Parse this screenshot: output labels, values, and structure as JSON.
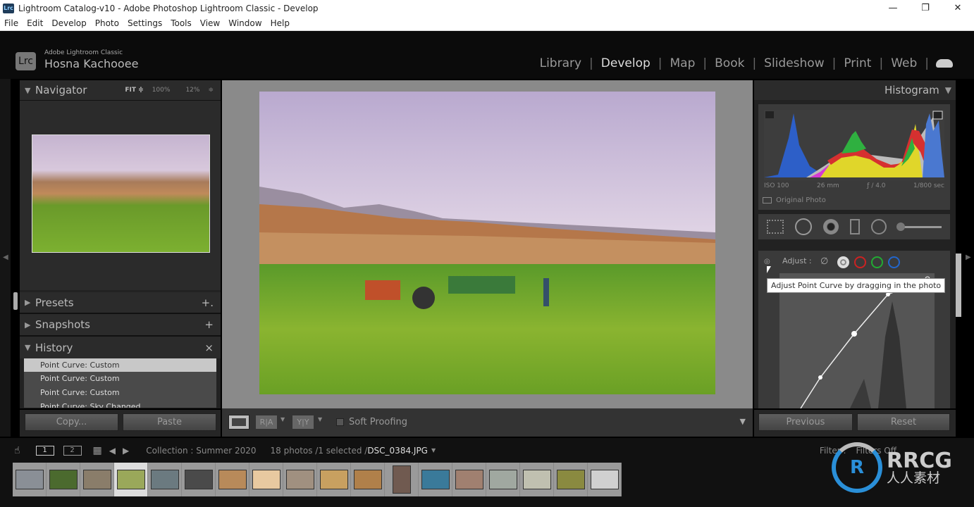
{
  "window": {
    "title": "Lightroom Catalog-v10 - Adobe Photoshop Lightroom Classic - Develop",
    "app_icon": "Lrc",
    "controls": [
      "—",
      "❐",
      "✕"
    ]
  },
  "menu": [
    "File",
    "Edit",
    "Develop",
    "Photo",
    "Settings",
    "Tools",
    "View",
    "Window",
    "Help"
  ],
  "identity": {
    "logo": "Lrc",
    "product": "Adobe Lightroom Classic",
    "user": "Hosna Kachooee"
  },
  "modules": [
    {
      "label": "Library"
    },
    {
      "label": "Develop",
      "active": true
    },
    {
      "label": "Map"
    },
    {
      "label": "Book"
    },
    {
      "label": "Slideshow"
    },
    {
      "label": "Print"
    },
    {
      "label": "Web"
    }
  ],
  "navigator": {
    "title": "Navigator",
    "fit": "FIT ≑",
    "z100": "100%",
    "z12": "12%",
    "arrows": "≑"
  },
  "presets": {
    "title": "Presets",
    "action": "+."
  },
  "snapshots": {
    "title": "Snapshots",
    "action": "+"
  },
  "history": {
    "title": "History",
    "action": "×",
    "items": [
      "Point Curve: Custom",
      "Point Curve: Custom",
      "Point Curve: Custom",
      "Point Curve: Sky Changed"
    ]
  },
  "left_buttons": {
    "copy": "Copy...",
    "paste": "Paste"
  },
  "toolbar": {
    "ra": "R|A",
    "yy": "Y|Y",
    "soft_proofing": "Soft Proofing",
    "soft_proofing_checked": false
  },
  "histogram": {
    "title": "Histogram",
    "iso": "ISO 100",
    "focal": "26 mm",
    "aperture": "ƒ / 4.0",
    "shutter": "1/800 sec",
    "original_photo": "Original Photo"
  },
  "tone_curve": {
    "adjust": "Adjust :",
    "tooltip": "Adjust Point Curve by dragging in the photo",
    "channels": [
      "#dddddd",
      "#cc2222",
      "#22aa33",
      "#2266cc"
    ]
  },
  "right_buttons": {
    "previous": "Previous",
    "reset": "Reset"
  },
  "filmstrip": {
    "view1": "1",
    "view2": "2",
    "collection": "Collection : Summer 2020",
    "count": "18 photos /1 selected /",
    "filename": "DSC_0384.JPG",
    "filter_label": "Filter :",
    "filter_value": "Filters Off",
    "thumbs": [
      "#8a8f96",
      "#4b6a2e",
      "#8a7d6a",
      "#9aa85a",
      "#6b7a80",
      "#4a4a4a",
      "#b88a5a",
      "#e8c9a0",
      "#a09080",
      "#c8a060",
      "#b0804a",
      "#705a50",
      "#3a7a9a",
      "#a08070",
      "#a0a8a0",
      "#c0c0b0",
      "#8a8a40",
      "#d0d0d0"
    ],
    "selected_index": 3
  },
  "watermark": {
    "text": "RRCG",
    "sub": "人人素材"
  }
}
